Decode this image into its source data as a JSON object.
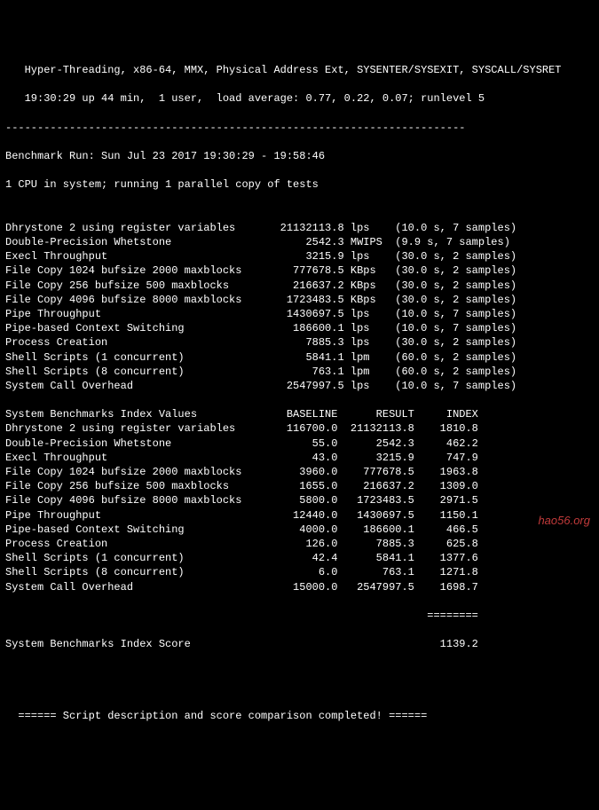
{
  "header": {
    "cpu_features": "   Hyper-Threading, x86-64, MMX, Physical Address Ext, SYSENTER/SYSEXIT, SYSCALL/SYSRET",
    "uptime": "   19:30:29 up 44 min,  1 user,  load average: 0.77, 0.22, 0.07; runlevel 5"
  },
  "divider": "------------------------------------------------------------------------",
  "run_info": {
    "line1": "Benchmark Run: Sun Jul 23 2017 19:30:29 - 19:58:46",
    "line2": "1 CPU in system; running 1 parallel copy of tests"
  },
  "results": [
    {
      "name": "Dhrystone 2 using register variables",
      "value": "21132113.8",
      "unit": "lps",
      "timing": "(10.0 s, 7 samples)"
    },
    {
      "name": "Double-Precision Whetstone",
      "value": "2542.3",
      "unit": "MWIPS",
      "timing": "(9.9 s, 7 samples)"
    },
    {
      "name": "Execl Throughput",
      "value": "3215.9",
      "unit": "lps",
      "timing": "(30.0 s, 2 samples)"
    },
    {
      "name": "File Copy 1024 bufsize 2000 maxblocks",
      "value": "777678.5",
      "unit": "KBps",
      "timing": "(30.0 s, 2 samples)"
    },
    {
      "name": "File Copy 256 bufsize 500 maxblocks",
      "value": "216637.2",
      "unit": "KBps",
      "timing": "(30.0 s, 2 samples)"
    },
    {
      "name": "File Copy 4096 bufsize 8000 maxblocks",
      "value": "1723483.5",
      "unit": "KBps",
      "timing": "(30.0 s, 2 samples)"
    },
    {
      "name": "Pipe Throughput",
      "value": "1430697.5",
      "unit": "lps",
      "timing": "(10.0 s, 7 samples)"
    },
    {
      "name": "Pipe-based Context Switching",
      "value": "186600.1",
      "unit": "lps",
      "timing": "(10.0 s, 7 samples)"
    },
    {
      "name": "Process Creation",
      "value": "7885.3",
      "unit": "lps",
      "timing": "(30.0 s, 2 samples)"
    },
    {
      "name": "Shell Scripts (1 concurrent)",
      "value": "5841.1",
      "unit": "lpm",
      "timing": "(60.0 s, 2 samples)"
    },
    {
      "name": "Shell Scripts (8 concurrent)",
      "value": "763.1",
      "unit": "lpm",
      "timing": "(60.0 s, 2 samples)"
    },
    {
      "name": "System Call Overhead",
      "value": "2547997.5",
      "unit": "lps",
      "timing": "(10.0 s, 7 samples)"
    }
  ],
  "index_header": {
    "label": "System Benchmarks Index Values",
    "c1": "BASELINE",
    "c2": "RESULT",
    "c3": "INDEX"
  },
  "index": [
    {
      "name": "Dhrystone 2 using register variables",
      "baseline": "116700.0",
      "result": "21132113.8",
      "index": "1810.8"
    },
    {
      "name": "Double-Precision Whetstone",
      "baseline": "55.0",
      "result": "2542.3",
      "index": "462.2"
    },
    {
      "name": "Execl Throughput",
      "baseline": "43.0",
      "result": "3215.9",
      "index": "747.9"
    },
    {
      "name": "File Copy 1024 bufsize 2000 maxblocks",
      "baseline": "3960.0",
      "result": "777678.5",
      "index": "1963.8"
    },
    {
      "name": "File Copy 256 bufsize 500 maxblocks",
      "baseline": "1655.0",
      "result": "216637.2",
      "index": "1309.0"
    },
    {
      "name": "File Copy 4096 bufsize 8000 maxblocks",
      "baseline": "5800.0",
      "result": "1723483.5",
      "index": "2971.5"
    },
    {
      "name": "Pipe Throughput",
      "baseline": "12440.0",
      "result": "1430697.5",
      "index": "1150.1"
    },
    {
      "name": "Pipe-based Context Switching",
      "baseline": "4000.0",
      "result": "186600.1",
      "index": "466.5"
    },
    {
      "name": "Process Creation",
      "baseline": "126.0",
      "result": "7885.3",
      "index": "625.8"
    },
    {
      "name": "Shell Scripts (1 concurrent)",
      "baseline": "42.4",
      "result": "5841.1",
      "index": "1377.6"
    },
    {
      "name": "Shell Scripts (8 concurrent)",
      "baseline": "6.0",
      "result": "763.1",
      "index": "1271.8"
    },
    {
      "name": "System Call Overhead",
      "baseline": "15000.0",
      "result": "2547997.5",
      "index": "1698.7"
    }
  ],
  "score_divider": "                                                                  ========",
  "score": {
    "label": "System Benchmarks Index Score",
    "value": "1139.2"
  },
  "footer": "====== Script description and score comparison completed! ======",
  "watermark": "hao56.org"
}
